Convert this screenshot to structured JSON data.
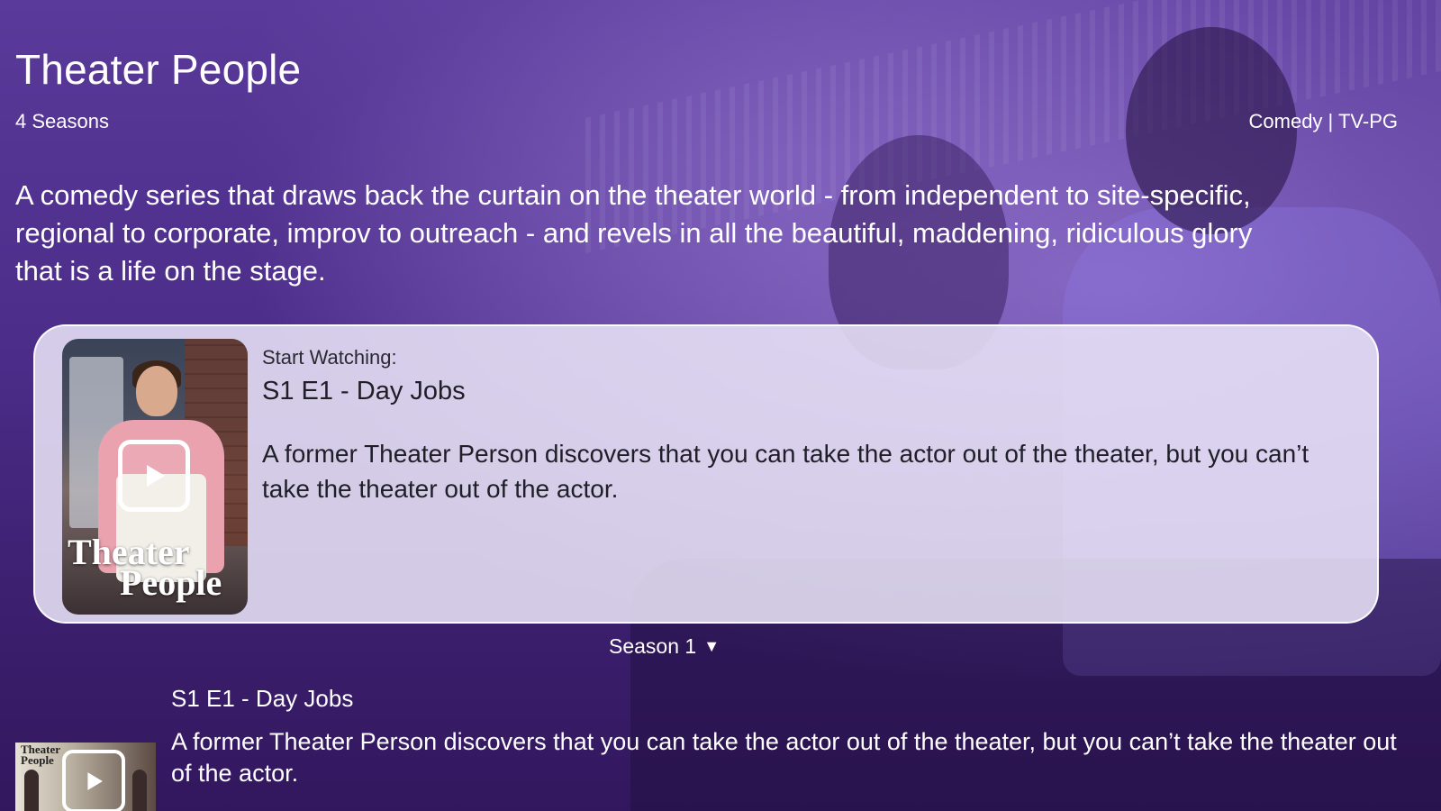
{
  "show": {
    "title": "Theater People",
    "seasons": "4 Seasons",
    "genre_rating": "Comedy | TV-PG",
    "description": "A comedy series that draws back the curtain on the theater world - from independent to site-specific, regional to corporate, improv to outreach - and revels in all the beautiful, maddening, ridiculous glory that is a life on the stage."
  },
  "featured": {
    "label": "Start Watching:",
    "episode": "S1 E1 - Day Jobs",
    "description": "A former Theater Person discovers that you can take the actor out of the theater, but you can’t take the theater out of the actor.",
    "poster_logo_line1": "Theater",
    "poster_logo_line2": "People",
    "play_icon": "play-icon"
  },
  "season_selector": {
    "label": "Season 1",
    "arrow": "▼"
  },
  "episodes": [
    {
      "title": "S1 E1 - Day Jobs",
      "description": "A former Theater Person discovers that you can take the actor out of the theater, but you can’t take the theater out of the actor.",
      "thumb_logo_line1": "Theater",
      "thumb_logo_line2": "People"
    }
  ],
  "colors": {
    "background": "#4b2c88",
    "card_background": "#e8e2f6",
    "text": "#ffffff",
    "card_text": "#1f1f28"
  }
}
